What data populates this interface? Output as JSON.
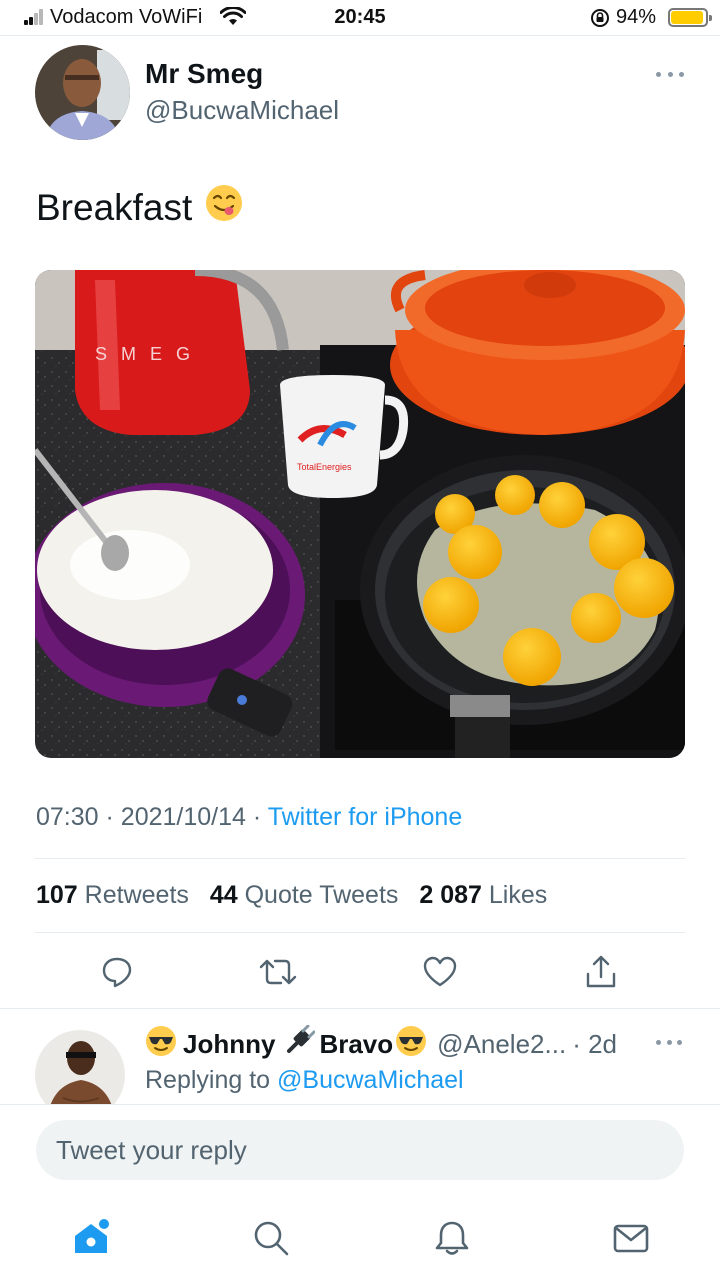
{
  "status_bar": {
    "carrier": "Vodacom VoWiFi",
    "time": "20:45",
    "battery": "94%",
    "battery_level": 0.94,
    "battery_color": "#ffcc00"
  },
  "tweet": {
    "display_name": "Mr Smeg",
    "handle": "@BucwaMichael",
    "text": "Breakfast",
    "emoji": "😋",
    "image_description_icon": "photo",
    "time": "07:30",
    "separator": "·",
    "date": "2021/10/14",
    "source": "Twitter for iPhone",
    "stats": {
      "retweets_count": "107",
      "retweets_label": "Retweets",
      "quotes_count": "44",
      "quotes_label": "Quote Tweets",
      "likes_count": "2 087",
      "likes_label": "Likes"
    },
    "kettle_brand": "SMEG",
    "mug_brand": "TotalEnergies"
  },
  "actions": [
    "reply-icon",
    "retweet-icon",
    "like-icon",
    "share-icon"
  ],
  "reply": {
    "emoji_start": "😎",
    "name_part1": "Johnny",
    "emoji_mid": "🔌",
    "name_part2": "Bravo",
    "emoji_end": "😎",
    "handle": "@Anele2...",
    "time": "· 2d",
    "replying_prefix": "Replying to",
    "replying_to": "@BucwaMichael"
  },
  "composer": {
    "placeholder": "Tweet your reply"
  },
  "tabbar": [
    "home-icon",
    "search-icon",
    "notifications-icon",
    "messages-icon"
  ],
  "colors": {
    "accent": "#1d9bf0",
    "secondary_text": "#536471",
    "primary_text": "#0f1419"
  }
}
